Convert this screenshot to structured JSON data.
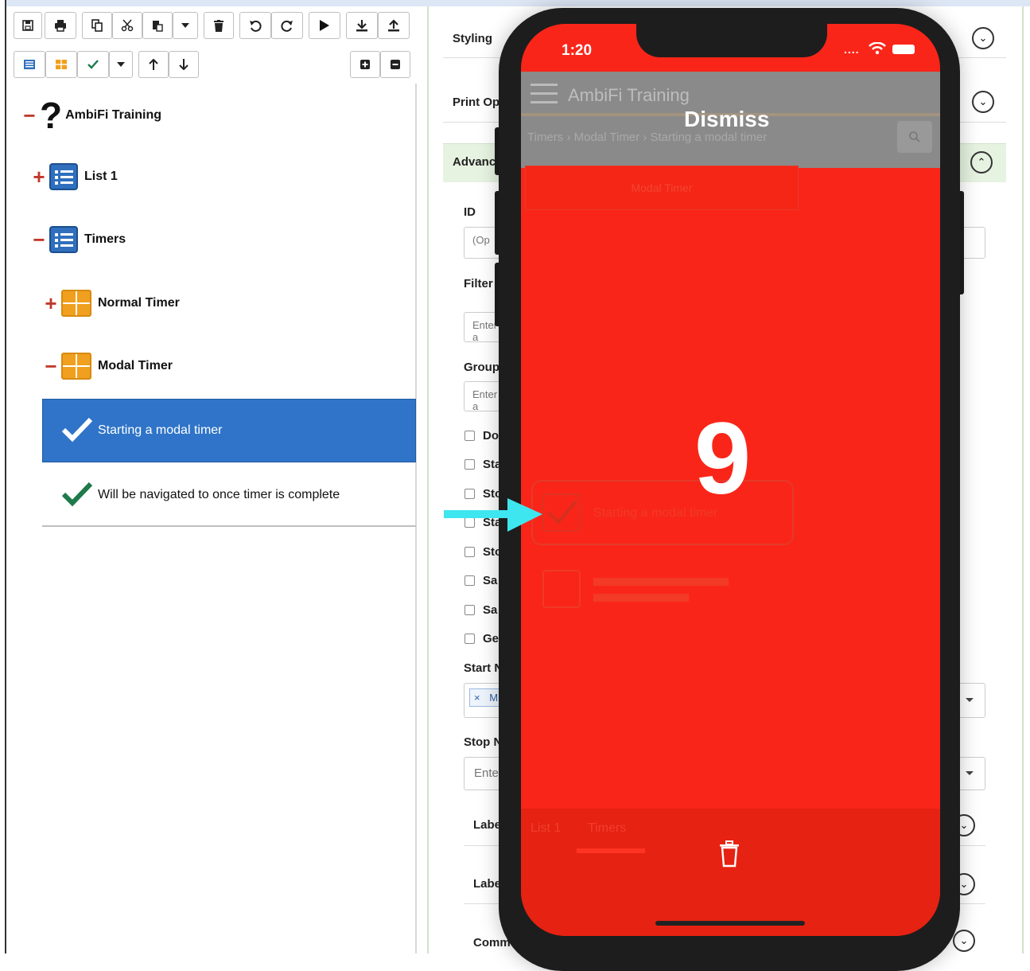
{
  "toolbar": {
    "row1": [
      "save-icon",
      "print-icon",
      "copy-icon",
      "cut-icon",
      "paste-icon",
      "caret-down-icon",
      "delete-icon",
      "undo-icon",
      "redo-icon",
      "play-icon",
      "download-icon",
      "upload-icon"
    ],
    "row2": [
      "list-icon",
      "grid-icon",
      "check-icon",
      "caret-down-icon",
      "arrow-up-icon",
      "arrow-down-icon",
      "expand-icon",
      "collapse-icon"
    ]
  },
  "tree": {
    "root": {
      "sign": "−",
      "label": "AmbiFi Training"
    },
    "list1": {
      "sign": "+",
      "label": "List 1"
    },
    "timers": {
      "sign": "−",
      "label": "Timers"
    },
    "normal_timer": {
      "sign": "+",
      "label": "Normal Timer"
    },
    "modal_timer": {
      "sign": "−",
      "label": "Modal Timer"
    },
    "selected_item": "Starting a modal timer",
    "next_item": "Will be navigated to once timer is complete"
  },
  "form": {
    "styling": "Styling",
    "print_options": "Print Op",
    "advanced": "Advanc",
    "id_label": "ID",
    "id_placeholder": "(Op",
    "filter_label": "Filter",
    "filter_placeholder": "Enter a",
    "group_label": "Group",
    "group_placeholder": "Enter a",
    "checkboxes": [
      "Do",
      "Sta",
      "Sto",
      "Sta",
      "Sto",
      "Sa",
      "Sa",
      "Ge"
    ],
    "start_label": "Start N",
    "tag_remove": "×",
    "tag_text": "M",
    "stop_label": "Stop N",
    "stop_placeholder": "Ente",
    "label1": "Labe",
    "label2": "Labe",
    "comment": "Commen"
  },
  "phone": {
    "time": "1:20",
    "signal": "....",
    "app_title": "AmbiFi Training",
    "dismiss": "Dismiss",
    "breadcrumb": [
      "Timers",
      "Modal Timer",
      "Starting a modal timer"
    ],
    "start_button": "Modal Timer",
    "countdown": "9",
    "faded_item": "Starting a modal timer",
    "tabs": [
      "List 1",
      "Timers"
    ]
  },
  "colors": {
    "modal_red": "#fa2519",
    "selection_blue": "#2f74c8",
    "arrow_cyan": "#3ee6ef",
    "grid_orange": "#f0a01e",
    "list_blue": "#2f6fbd",
    "check_green": "#1e7a4a"
  }
}
